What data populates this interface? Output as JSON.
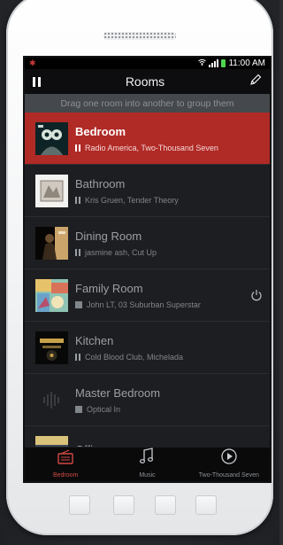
{
  "status_bar": {
    "time": "11:00 AM"
  },
  "header": {
    "title": "Rooms"
  },
  "hint": "Drag one room into another to group them",
  "rooms": [
    {
      "name": "Bedroom",
      "track": "Radio America, Two-Thousand Seven",
      "state": "playing",
      "art_icon": "album-art-owl-icon"
    },
    {
      "name": "Bathroom",
      "track": "Kris Gruen, Tender Theory",
      "state": "playing",
      "art_icon": "album-art-sketch-icon"
    },
    {
      "name": "Dining Room",
      "track": "jasmine ash, Cut Up",
      "state": "playing",
      "art_icon": "album-art-figure-icon"
    },
    {
      "name": "Family Room",
      "track": "John LT, 03 Suburban Superstar",
      "state": "stopped",
      "art_icon": "album-art-collage-icon"
    },
    {
      "name": "Kitchen",
      "track": "Cold Blood Club, Michelada",
      "state": "playing",
      "art_icon": "album-art-dark-icon"
    },
    {
      "name": "Master Bedroom",
      "track": "Optical In",
      "state": "stopped",
      "art_icon": "waveform-icon"
    },
    {
      "name": "Office",
      "track": "",
      "state": "",
      "art_icon": "album-art-office-icon"
    }
  ],
  "tabs": [
    {
      "label": "Bedroom",
      "icon": "speaker-icon",
      "active": true
    },
    {
      "label": "Music",
      "icon": "music-note-icon",
      "active": false
    },
    {
      "label": "Two-Thousand Seven",
      "icon": "play-circle-icon",
      "active": false
    }
  ],
  "colors": {
    "accent": "#b02a26",
    "active_tab": "#d24a43"
  }
}
